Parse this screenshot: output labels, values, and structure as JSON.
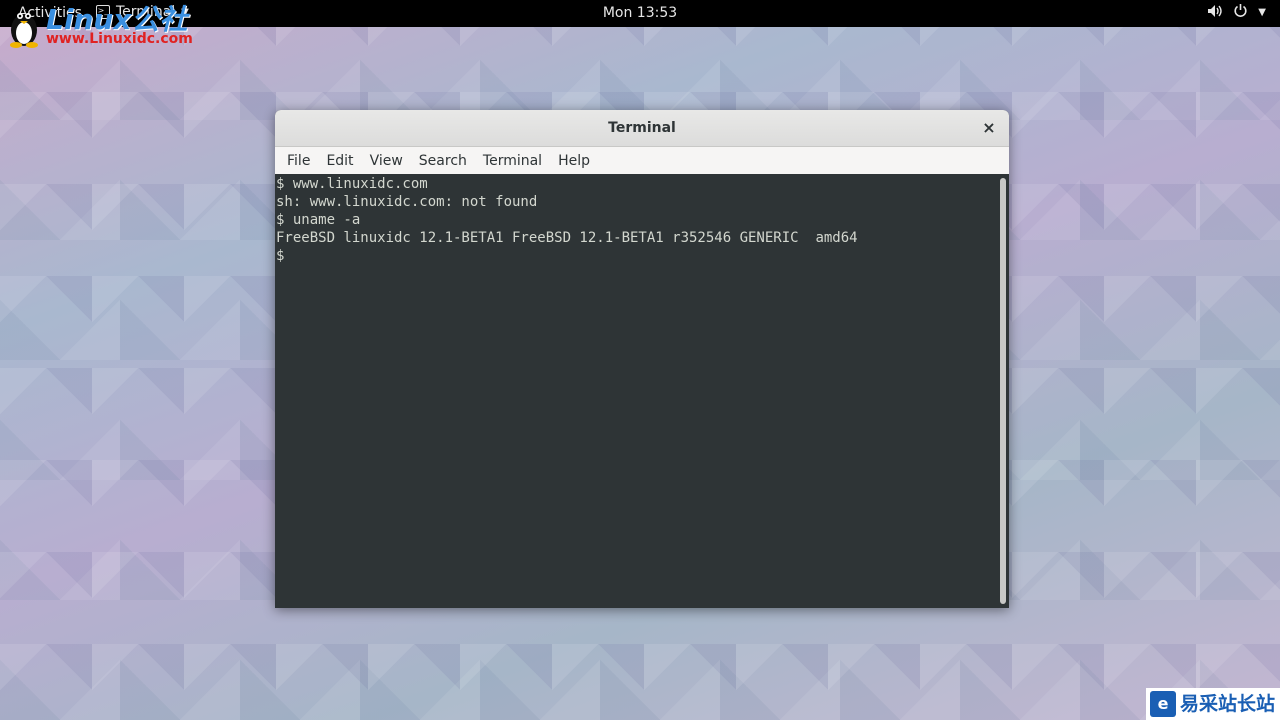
{
  "topbar": {
    "activities": "Activities",
    "app_menu_label": "Terminal",
    "clock": "Mon 13:53"
  },
  "logo": {
    "brand": "Linux公社",
    "url": "www.Linuxidc.com"
  },
  "window": {
    "title": "Terminal",
    "close_glyph": "×",
    "menu": [
      "File",
      "Edit",
      "View",
      "Search",
      "Terminal",
      "Help"
    ],
    "lines": [
      "$ www.linuxidc.com",
      "sh: www.linuxidc.com: not found",
      "$ uname -a",
      "FreeBSD linuxidc 12.1-BETA1 FreeBSD 12.1-BETA1 r352546 GENERIC  amd64",
      "$"
    ]
  },
  "watermark": {
    "text": "易采站长站"
  },
  "colors": {
    "terminal_bg": "#2e3436",
    "terminal_fg": "#d3d7cf",
    "topbar_bg": "#000000"
  },
  "icons": [
    "tux-icon",
    "terminal-app-icon",
    "volume-icon",
    "power-icon",
    "chevron-down-icon",
    "close-icon"
  ]
}
